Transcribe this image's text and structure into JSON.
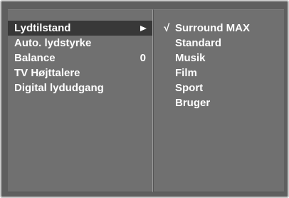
{
  "left_menu": {
    "items": [
      {
        "label": "Lydtilstand",
        "value": "",
        "selected": true,
        "submenu": true
      },
      {
        "label": "Auto. lydstyrke",
        "value": ""
      },
      {
        "label": "Balance",
        "value": "0"
      },
      {
        "label": "TV Højttalere",
        "value": ""
      },
      {
        "label": "Digital lydudgang",
        "value": ""
      }
    ]
  },
  "right_menu": {
    "check_glyph": "√",
    "items": [
      {
        "label": "Surround MAX",
        "checked": true
      },
      {
        "label": "Standard"
      },
      {
        "label": "Musik"
      },
      {
        "label": "Film"
      },
      {
        "label": "Sport"
      },
      {
        "label": "Bruger"
      }
    ]
  },
  "colors": {
    "frame_border": "#c8c8c8",
    "panel_bg": "#707070",
    "selected_bg": "#383838",
    "text": "#ffffff"
  }
}
